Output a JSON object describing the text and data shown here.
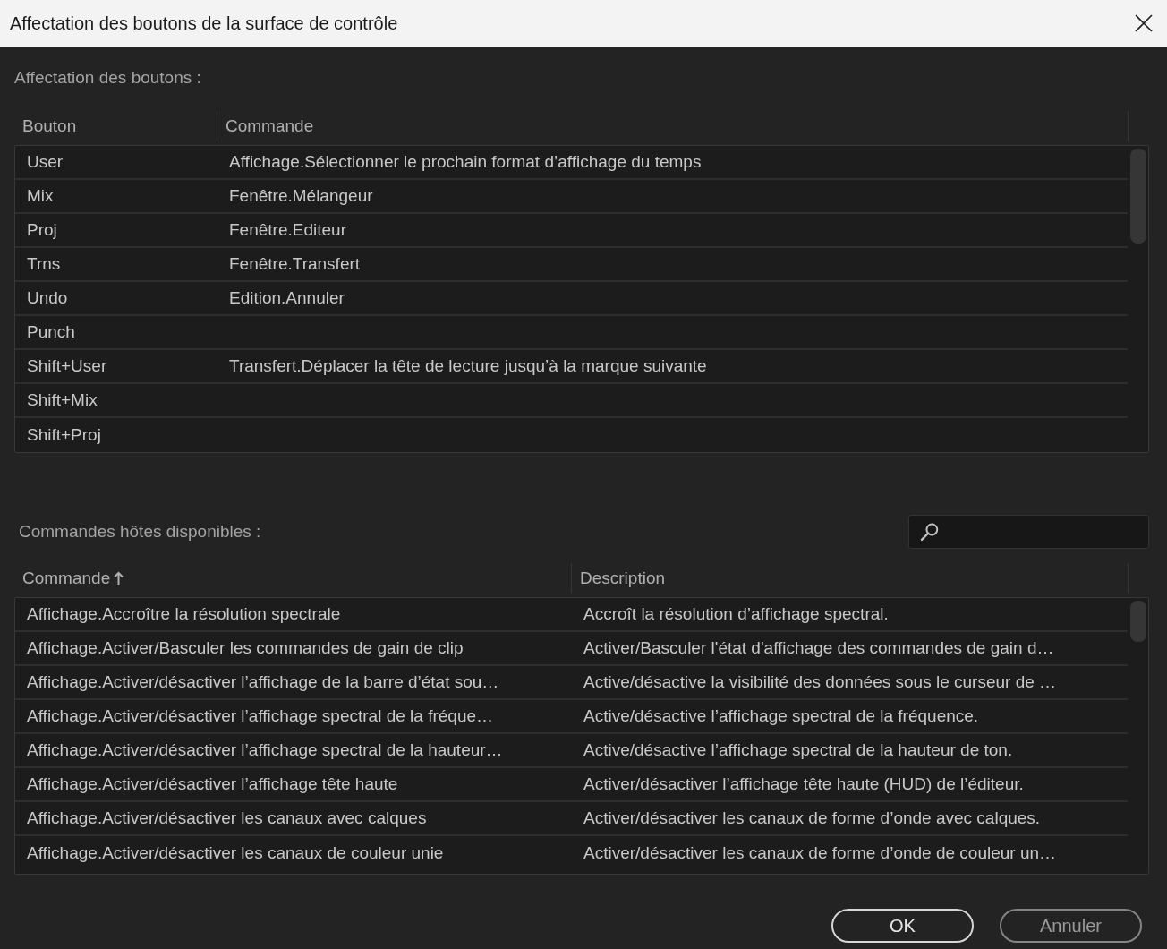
{
  "window": {
    "title": "Affectation des boutons de la surface de contrôle"
  },
  "assignments": {
    "label": "Affectation des boutons :",
    "columns": [
      {
        "label": "Bouton"
      },
      {
        "label": "Commande"
      }
    ],
    "rows": [
      {
        "button": "User",
        "command": "Affichage.Sélectionner le prochain format d’affichage du temps"
      },
      {
        "button": "Mix",
        "command": "Fenêtre.Mélangeur"
      },
      {
        "button": "Proj",
        "command": "Fenêtre.Editeur"
      },
      {
        "button": "Trns",
        "command": "Fenêtre.Transfert"
      },
      {
        "button": "Undo",
        "command": "Edition.Annuler"
      },
      {
        "button": "Punch"
      },
      {
        "button": "Shift+User",
        "command": "Transfert.Déplacer la tête de lecture jusqu’à la marque suivante"
      },
      {
        "button": "Shift+Mix"
      },
      {
        "button": "Shift+Proj"
      }
    ]
  },
  "host_commands": {
    "label": "Commandes hôtes disponibles :",
    "columns": [
      {
        "label": "Commande",
        "sorted": true
      },
      {
        "label": "Description",
        "sorted": false
      }
    ],
    "rows": [
      {
        "command": "Affichage.Accroître la résolution spectrale",
        "description": "Accroît la résolution d’affichage spectral."
      },
      {
        "command": "Affichage.Activer/Basculer les commandes de gain de clip",
        "description": "Activer/Basculer l'état d'affichage des commandes de gain d…"
      },
      {
        "command": "Affichage.Activer/désactiver l’affichage de la barre d’état sou…",
        "description": "Active/désactive la visibilité des données sous le curseur de …"
      },
      {
        "command": "Affichage.Activer/désactiver l’affichage spectral de la fréque…",
        "description": "Active/désactive l’affichage spectral de la fréquence."
      },
      {
        "command": "Affichage.Activer/désactiver l’affichage spectral de la hauteur…",
        "description": "Active/désactive l’affichage spectral de la hauteur de ton."
      },
      {
        "command": "Affichage.Activer/désactiver l’affichage tête haute",
        "description": "Activer/désactiver l’affichage tête haute (HUD) de l’éditeur."
      },
      {
        "command": "Affichage.Activer/désactiver les canaux avec calques",
        "description": "Activer/désactiver les canaux de forme d’onde avec calques."
      },
      {
        "command": "Affichage.Activer/désactiver les canaux de couleur unie",
        "description": "Activer/désactiver les canaux de forme d’onde de couleur un…"
      }
    ]
  },
  "buttons": [
    {
      "label": "OK",
      "primary": true
    },
    {
      "label": "Annuler",
      "primary": false
    }
  ]
}
